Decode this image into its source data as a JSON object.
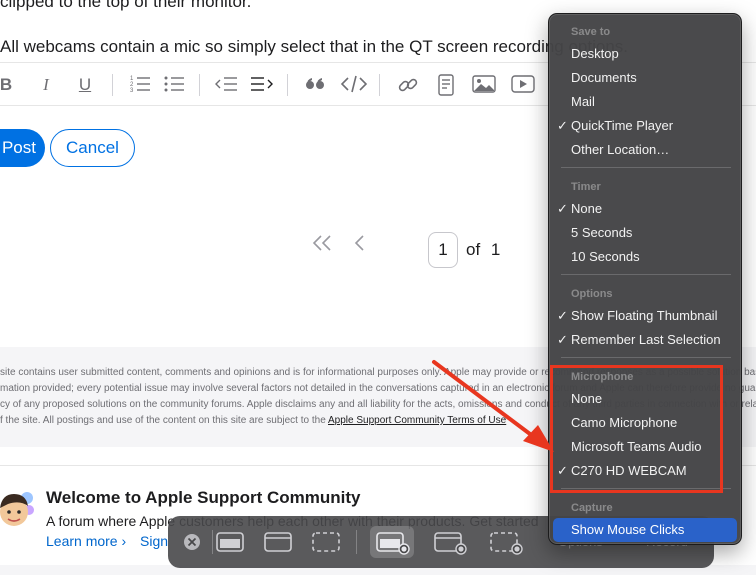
{
  "post": {
    "line1": "clipped to the top of their monitor.",
    "line2": "All webcams contain a mic so simply select that in the QT screen recording options."
  },
  "editor_toolbar": {
    "bold": "B",
    "italic": "I",
    "underline": "U"
  },
  "buttons": {
    "post": "Post",
    "cancel": "Cancel"
  },
  "pagination": {
    "current_page": "1",
    "of_label": "of",
    "total_pages": "1"
  },
  "disclaimer": {
    "line1": "site contains user submitted content, comments and opinions and is for informational purposes only. Apple may provide or recommend responses as a possible solution based on the information provided; every potential issue may involve",
    "line2": "mation provided; every potential issue may involve several factors not detailed in the conversations captured in an electronic forum and Apple can therefore provide no guarantee as",
    "line3": "cy of any proposed solutions on the community forums. Apple disclaims any and all liability for the acts, omissions and conduct of any third parties in connection with or related to your use",
    "line4_prefix": "f the site. All postings and use of the content on this site are subject to the ",
    "line4_link": "Apple Support Community Terms of Use"
  },
  "welcome": {
    "title": "Welcome to Apple Support Community",
    "description": "A forum where Apple customers help each other with their products. Get started",
    "learn_more": "Learn more",
    "sign": "Sign"
  },
  "capture_bar": {
    "options_ghost": "Options",
    "record_ghost": "Record"
  },
  "menu": {
    "sections": [
      {
        "header": "Save to",
        "items": [
          {
            "label": "Desktop",
            "checked": false
          },
          {
            "label": "Documents",
            "checked": false
          },
          {
            "label": "Mail",
            "checked": false
          },
          {
            "label": "QuickTime Player",
            "checked": true
          },
          {
            "label": "Other Location…",
            "checked": false
          }
        ]
      },
      {
        "header": "Timer",
        "items": [
          {
            "label": "None",
            "checked": true
          },
          {
            "label": "5 Seconds",
            "checked": false
          },
          {
            "label": "10 Seconds",
            "checked": false
          }
        ]
      },
      {
        "header": "Options",
        "items": [
          {
            "label": "Show Floating Thumbnail",
            "checked": true
          },
          {
            "label": "Remember Last Selection",
            "checked": true
          }
        ]
      },
      {
        "header": "Microphone",
        "items": [
          {
            "label": "None",
            "checked": false
          },
          {
            "label": "Camo Microphone",
            "checked": false
          },
          {
            "label": "Microsoft Teams Audio",
            "checked": false
          },
          {
            "label": "C270 HD WEBCAM",
            "checked": true
          }
        ]
      },
      {
        "header": "Capture",
        "items": [
          {
            "label": "Show Mouse Clicks",
            "checked": false,
            "highlighted": true
          }
        ]
      }
    ]
  },
  "colors": {
    "accent": "#0071e3",
    "menu_highlight": "#2a62c9",
    "annotation_red": "#e8361f"
  }
}
